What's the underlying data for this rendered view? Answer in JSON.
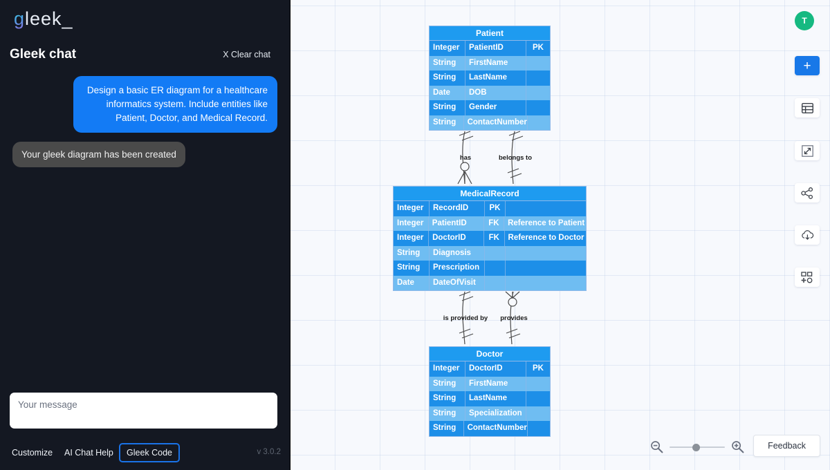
{
  "brand": {
    "logo_g": "g",
    "logo_rest": "leek_"
  },
  "sidebar": {
    "chat_title": "Gleek chat",
    "clear_chat": "X Clear chat",
    "messages": [
      {
        "role": "user",
        "text": "Design a basic ER diagram for a healthcare informatics system. Include entities like Patient, Doctor, and Medical Record."
      },
      {
        "role": "bot",
        "text": "Your gleek diagram has been created"
      }
    ],
    "input_placeholder": "Your message",
    "input_value": "",
    "footer": {
      "customize": "Customize",
      "ai_chat_help": "AI Chat Help",
      "gleek_code": "Gleek Code",
      "version": "v 3.0.2"
    }
  },
  "toolbar": {
    "avatar_initial": "T",
    "add_label": "+",
    "icons": [
      "table-icon",
      "expand-icon",
      "share-icon",
      "cloud-download-icon",
      "shapes-icon"
    ]
  },
  "zoom_controls": {
    "zoom_out": "zoom-out-icon",
    "zoom_in": "zoom-in-icon",
    "level_percent": 40
  },
  "feedback": {
    "label": "Feedback"
  },
  "colors": {
    "accent_blue": "#137bf5",
    "entity_header": "#1e9bf0",
    "row_dark": "#1d8fe8",
    "row_light": "#6fbdf2",
    "avatar_green": "#16b981",
    "canvas_bg": "#f7f9fd"
  },
  "chart_data": {
    "type": "diagram",
    "notation": "crow's foot ER diagram",
    "entities": [
      {
        "name": "Patient",
        "columns": [
          "type",
          "name",
          "key"
        ],
        "rows": [
          {
            "type": "Integer",
            "name": "PatientID",
            "key": "PK"
          },
          {
            "type": "String",
            "name": "FirstName",
            "key": ""
          },
          {
            "type": "String",
            "name": "LastName",
            "key": ""
          },
          {
            "type": "Date",
            "name": "DOB",
            "key": ""
          },
          {
            "type": "String",
            "name": "Gender",
            "key": ""
          },
          {
            "type": "String",
            "name": "ContactNumber",
            "key": ""
          }
        ]
      },
      {
        "name": "MedicalRecord",
        "columns": [
          "type",
          "name",
          "key",
          "note"
        ],
        "rows": [
          {
            "type": "Integer",
            "name": "RecordID",
            "key": "PK",
            "note": ""
          },
          {
            "type": "Integer",
            "name": "PatientID",
            "key": "FK",
            "note": "Reference to Patient"
          },
          {
            "type": "Integer",
            "name": "DoctorID",
            "key": "FK",
            "note": "Reference to Doctor"
          },
          {
            "type": "String",
            "name": "Diagnosis",
            "key": "",
            "note": ""
          },
          {
            "type": "String",
            "name": "Prescription",
            "key": "",
            "note": ""
          },
          {
            "type": "Date",
            "name": "DateOfVisit",
            "key": "",
            "note": ""
          }
        ]
      },
      {
        "name": "Doctor",
        "columns": [
          "type",
          "name",
          "key"
        ],
        "rows": [
          {
            "type": "Integer",
            "name": "DoctorID",
            "key": "PK"
          },
          {
            "type": "String",
            "name": "FirstName",
            "key": ""
          },
          {
            "type": "String",
            "name": "LastName",
            "key": ""
          },
          {
            "type": "String",
            "name": "Specialization",
            "key": ""
          },
          {
            "type": "String",
            "name": "ContactNumber",
            "key": ""
          }
        ]
      }
    ],
    "relationships": [
      {
        "from": "Patient",
        "to": "MedicalRecord",
        "label": "has",
        "from_card": "one",
        "to_card": "zero-or-many"
      },
      {
        "from": "MedicalRecord",
        "to": "Patient",
        "label": "belongs to",
        "from_card": "one",
        "to_card": "one"
      },
      {
        "from": "MedicalRecord",
        "to": "Doctor",
        "label": "is provided by",
        "from_card": "one",
        "to_card": "one"
      },
      {
        "from": "Doctor",
        "to": "MedicalRecord",
        "label": "provides",
        "from_card": "zero-or-many",
        "to_card": "one"
      }
    ]
  }
}
